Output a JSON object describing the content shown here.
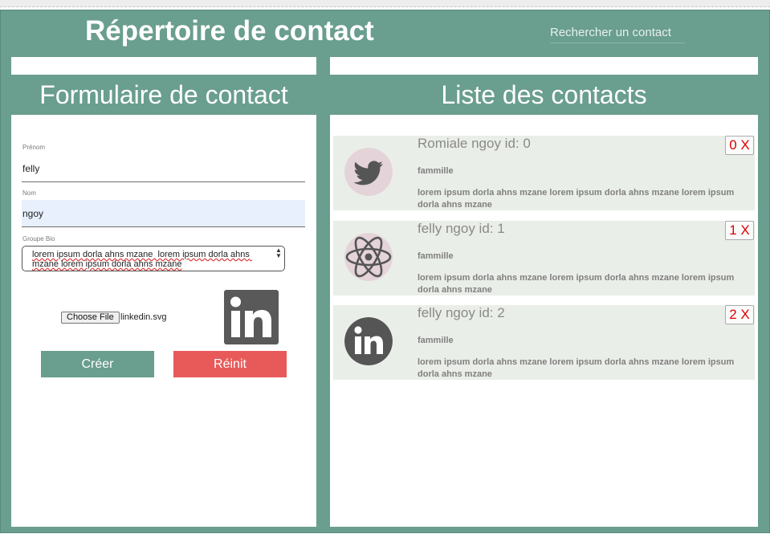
{
  "app": {
    "title": "Répertoire de contact",
    "search_placeholder": "Rechercher un contact"
  },
  "form": {
    "heading": "Formulaire de contact",
    "prenom_label": "Prénom",
    "prenom_value": "felly",
    "nom_label": "Nom",
    "nom_value": "ngoy",
    "bio_label": "Groupe Bio",
    "bio_value": "lorem ipsum dorla ahns mzane  lorem ipsum dorla ahns mzane lorem ipsum dorla ahns mzane",
    "file_button": "Choose File",
    "file_name": "linkedin.svg",
    "preview_icon": "linkedin-icon",
    "create_label": "Créer",
    "reset_label": "Réinit"
  },
  "list": {
    "heading": "Liste des contacts",
    "contacts": [
      {
        "name": "Romiale ngoy id: 0",
        "group": "fammille",
        "bio": "lorem ipsum dorla ahns mzane lorem ipsum dorla ahns mzane lorem ipsum dorla ahns mzane",
        "delete_label": "0 X",
        "avatar": "twitter-icon"
      },
      {
        "name": "felly ngoy id: 1",
        "group": "fammille",
        "bio": "lorem ipsum dorla ahns mzane lorem ipsum dorla ahns mzane lorem ipsum dorla ahns mzane",
        "delete_label": "1 X",
        "avatar": "react-icon"
      },
      {
        "name": "felly ngoy id: 2",
        "group": "fammille",
        "bio": "lorem ipsum dorla ahns mzane lorem ipsum dorla ahns mzane lorem ipsum dorla ahns mzane",
        "delete_label": "2 X",
        "avatar": "linkedin-icon"
      }
    ]
  },
  "colors": {
    "accent": "#6a9e8e",
    "danger": "#e85a5a",
    "card_bg": "#eaeee8",
    "delete_text": "#e00000"
  }
}
